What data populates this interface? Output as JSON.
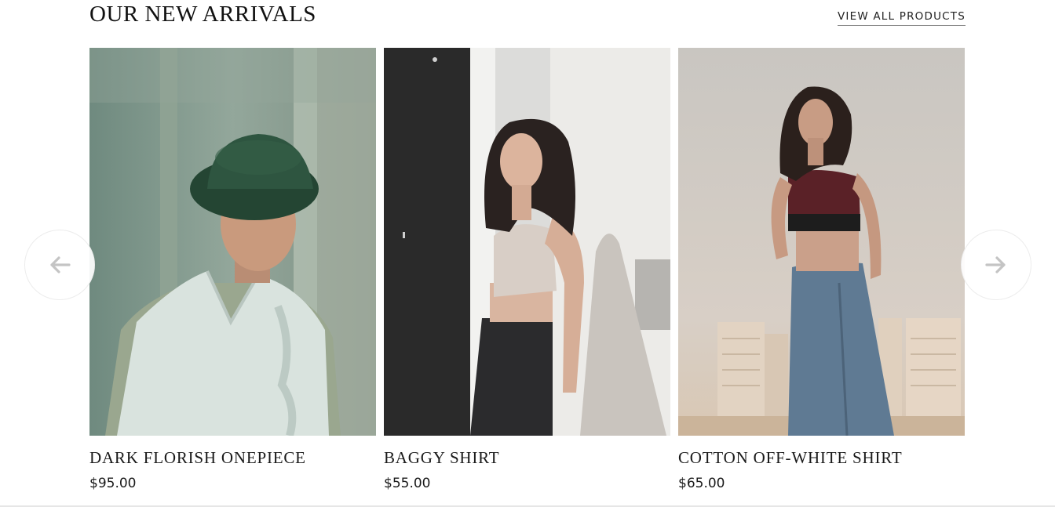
{
  "section": {
    "title": "OUR NEW ARRIVALS",
    "view_all_label": "VIEW ALL PRODUCTS"
  },
  "navigation": {
    "prev_icon": "arrow-left-icon",
    "next_icon": "arrow-right-icon"
  },
  "products": [
    {
      "name": "DARK FLORISH ONEPIECE",
      "price": "$95.00",
      "image": "man-in-green-bucket-hat-and-white-knit-vest-photo"
    },
    {
      "name": "BAGGY SHIRT",
      "price": "$55.00",
      "image": "woman-in-beige-crop-top-and-black-jeans-photo"
    },
    {
      "name": "COTTON OFF-WHITE SHIRT",
      "price": "$65.00",
      "image": "woman-in-maroon-sports-top-and-blue-jeans-photo"
    }
  ],
  "colors": {
    "text": "#1a1a1a",
    "arrow": "#c4c4c4",
    "arrow_border": "#ececec"
  }
}
